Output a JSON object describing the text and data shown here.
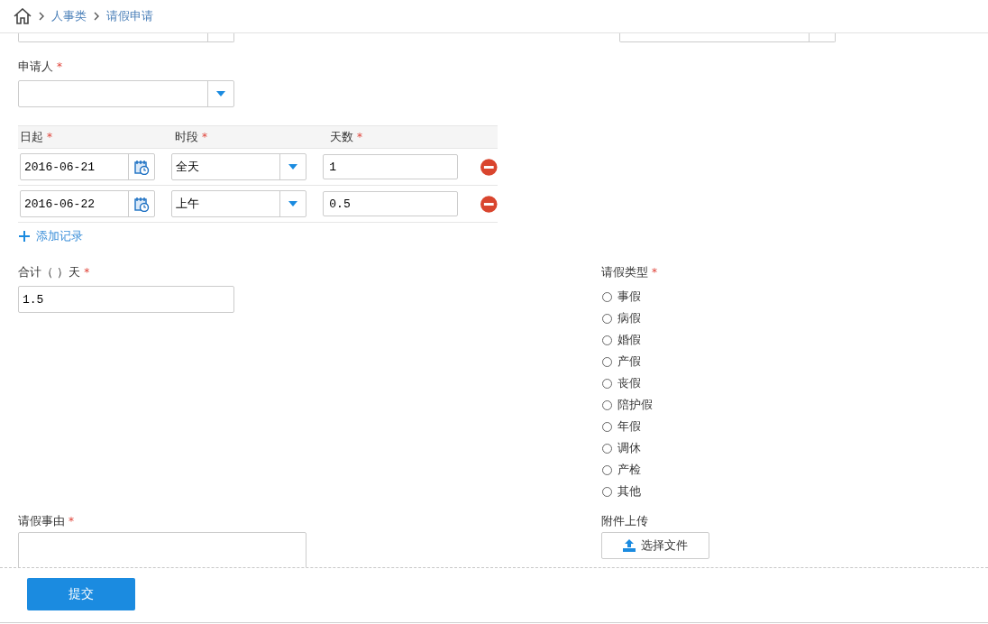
{
  "breadcrumb": {
    "items": [
      {
        "label": "人事类"
      },
      {
        "label": "请假申请"
      }
    ]
  },
  "hidden_fields": [
    {
      "kind": "select"
    },
    {
      "kind": "select"
    }
  ],
  "applicant": {
    "label": "申请人",
    "required_mark": "*"
  },
  "table": {
    "columns": [
      {
        "label": "日起",
        "required_mark": "*"
      },
      {
        "label": "时段",
        "required_mark": "*"
      },
      {
        "label": "天数",
        "required_mark": "*"
      }
    ],
    "rows": [
      {
        "date": "2016-06-21",
        "period": "全天",
        "days": "1"
      },
      {
        "date": "2016-06-22",
        "period": "上午",
        "days": "0.5"
      }
    ],
    "add_link": "添加记录"
  },
  "total": {
    "label": "合计（ ）天",
    "required_mark": "*",
    "value": "1.5"
  },
  "leave_type": {
    "label": "请假类型",
    "required_mark": "*",
    "options": [
      {
        "label": "事假",
        "selected": false
      },
      {
        "label": "病假",
        "selected": false
      },
      {
        "label": "婚假",
        "selected": false
      },
      {
        "label": "产假",
        "selected": false
      },
      {
        "label": "丧假",
        "selected": false
      },
      {
        "label": "陪护假",
        "selected": false
      },
      {
        "label": "年假",
        "selected": false
      },
      {
        "label": "调休",
        "selected": false
      },
      {
        "label": "产检",
        "selected": false
      },
      {
        "label": "其他",
        "selected": false
      }
    ]
  },
  "reason": {
    "label": "请假事由",
    "required_mark": "*"
  },
  "attachment": {
    "label": "附件上传",
    "button": "选择文件"
  },
  "submit": "提交"
}
